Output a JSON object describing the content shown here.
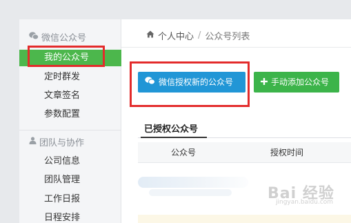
{
  "sidebar": {
    "group1": {
      "icon": "wechat-icon",
      "label": "微信公众号"
    },
    "items1": [
      {
        "label": "我的公众号",
        "active": true
      },
      {
        "label": "定时群发",
        "active": false
      },
      {
        "label": "文章签名",
        "active": false
      },
      {
        "label": "参数配置",
        "active": false
      }
    ],
    "group2": {
      "icon": "user-icon",
      "label": "团队与协作"
    },
    "items2": [
      {
        "label": "公司信息"
      },
      {
        "label": "团队管理"
      },
      {
        "label": "工作日报"
      },
      {
        "label": "日程安排"
      }
    ]
  },
  "breadcrumb": {
    "home_icon": "home-icon",
    "home": "个人中心",
    "separator": "/",
    "current": "公众号列表"
  },
  "actions": {
    "wechat_button": {
      "icon": "wechat-icon",
      "label": "微信授权新的公众号",
      "color": "#2196d6"
    },
    "add_button": {
      "icon": "plus-icon",
      "label": "手动添加公众号",
      "color": "#3cb44a"
    }
  },
  "section": {
    "title": "已授权公众号"
  },
  "table": {
    "columns": [
      "公众号",
      "授权时间"
    ]
  },
  "watermark": {
    "text": "Bai 经验",
    "sub": "jingyan.baidu.com"
  },
  "colors": {
    "active_nav": "#4cb74c",
    "annotation": "#e32b2b"
  }
}
